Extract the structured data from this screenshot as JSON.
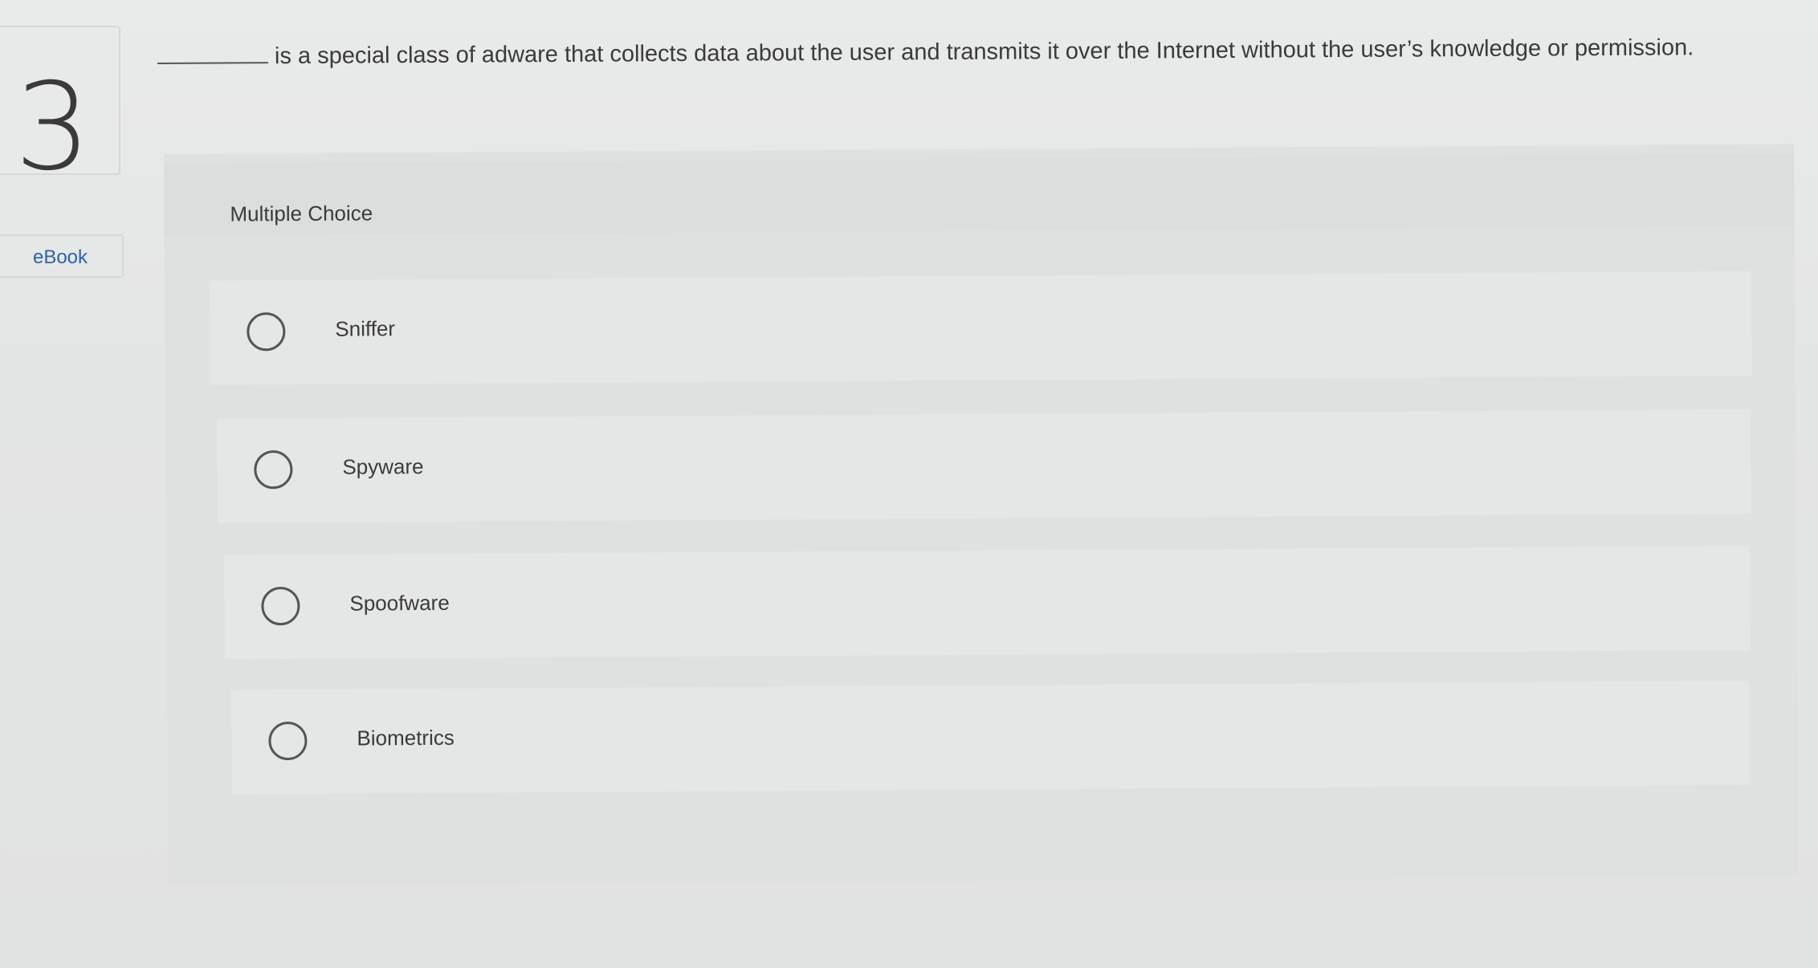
{
  "question": {
    "number": "3",
    "text": "is a special class of adware that collects data about the user and transmits it over the Internet without the user’s knowledge or permission."
  },
  "sidebar": {
    "ebook_label": "eBook"
  },
  "panel": {
    "title": "Multiple Choice",
    "choices": [
      {
        "label": "Sniffer"
      },
      {
        "label": "Spyware"
      },
      {
        "label": "Spoofware"
      },
      {
        "label": "Biometrics"
      }
    ]
  }
}
